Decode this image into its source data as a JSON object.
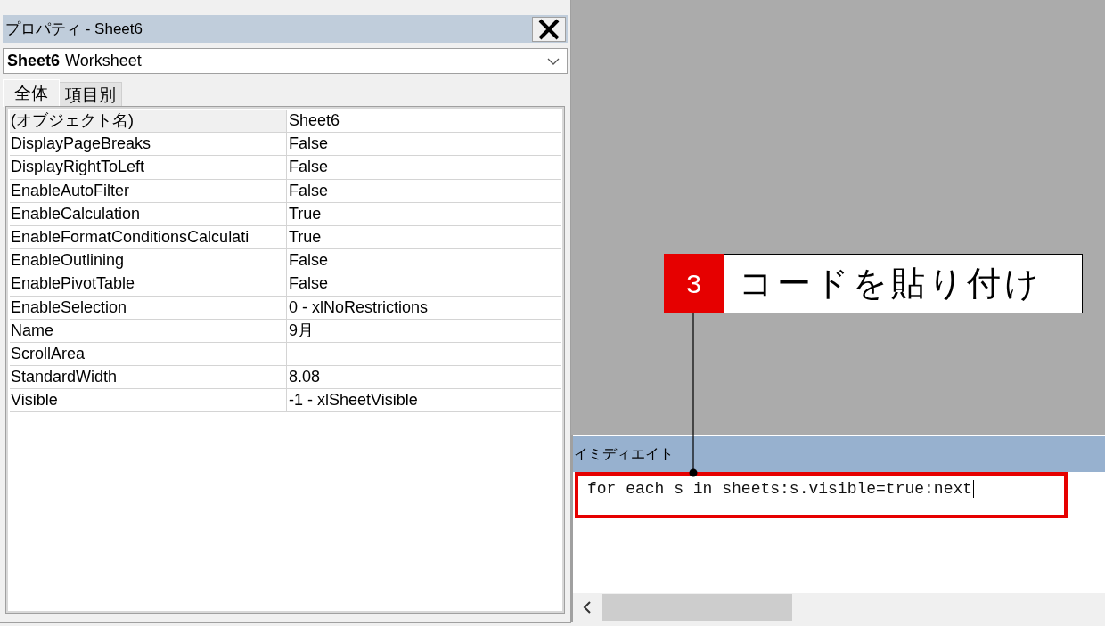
{
  "properties_window": {
    "title": "プロパティ - Sheet6",
    "object_selector": {
      "name": "Sheet6",
      "type": "Worksheet"
    },
    "tabs": [
      {
        "label": "全体",
        "selected": true
      },
      {
        "label": "項目別",
        "selected": false
      }
    ],
    "properties": [
      {
        "name": "(オブジェクト名)",
        "value": "Sheet6",
        "selected": true
      },
      {
        "name": "DisplayPageBreaks",
        "value": "False",
        "selected": false
      },
      {
        "name": "DisplayRightToLeft",
        "value": "False",
        "selected": false
      },
      {
        "name": "EnableAutoFilter",
        "value": "False",
        "selected": false
      },
      {
        "name": "EnableCalculation",
        "value": "True",
        "selected": false
      },
      {
        "name": "EnableFormatConditionsCalculati",
        "value": "True",
        "selected": false
      },
      {
        "name": "EnableOutlining",
        "value": "False",
        "selected": false
      },
      {
        "name": "EnablePivotTable",
        "value": "False",
        "selected": false
      },
      {
        "name": "EnableSelection",
        "value": "0 - xlNoRestrictions",
        "selected": false
      },
      {
        "name": "Name",
        "value": "9月",
        "selected": false
      },
      {
        "name": "ScrollArea",
        "selected": false
      },
      {
        "name": "StandardWidth",
        "value": "8.08",
        "selected": false
      },
      {
        "name": "Visible",
        "value": "-1 - xlSheetVisible",
        "selected": false
      }
    ]
  },
  "immediate_window": {
    "title": "イミディエイト",
    "code": "for each s in sheets:s.visible=true:next"
  },
  "callout": {
    "number": "3",
    "text": "コードを貼り付け"
  }
}
